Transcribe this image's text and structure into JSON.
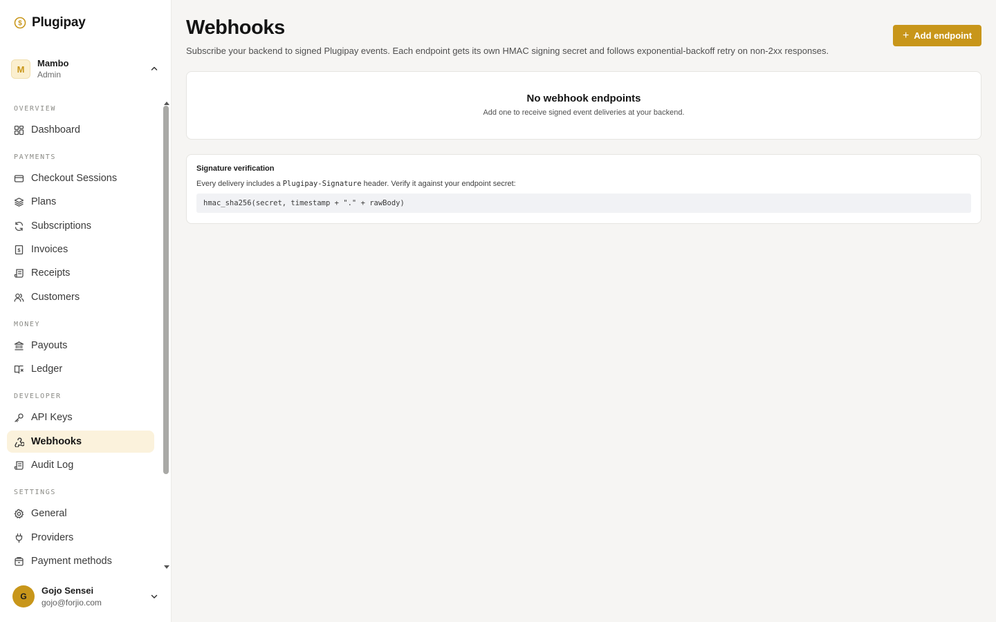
{
  "brand": {
    "name": "Plugipay",
    "accent": "#c8961a"
  },
  "org": {
    "initial": "M",
    "name": "Mambo",
    "role": "Admin"
  },
  "nav": {
    "sections": [
      {
        "label": "Overview"
      },
      {
        "label": "Payments"
      },
      {
        "label": "Money"
      },
      {
        "label": "Developer"
      },
      {
        "label": "Settings"
      }
    ],
    "items": [
      {
        "label": "Dashboard",
        "icon": "grid-icon"
      },
      {
        "label": "Checkout Sessions",
        "icon": "card-icon"
      },
      {
        "label": "Plans",
        "icon": "layers-icon"
      },
      {
        "label": "Subscriptions",
        "icon": "refresh-icon"
      },
      {
        "label": "Invoices",
        "icon": "dollar-file-icon"
      },
      {
        "label": "Receipts",
        "icon": "receipt-icon"
      },
      {
        "label": "Customers",
        "icon": "users-icon"
      },
      {
        "label": "Payouts",
        "icon": "bank-icon"
      },
      {
        "label": "Ledger",
        "icon": "book-icon"
      },
      {
        "label": "API Keys",
        "icon": "key-icon"
      },
      {
        "label": "Webhooks",
        "icon": "webhook-icon",
        "active": true
      },
      {
        "label": "Audit Log",
        "icon": "log-icon"
      },
      {
        "label": "General",
        "icon": "gear-icon"
      },
      {
        "label": "Providers",
        "icon": "plug-icon"
      },
      {
        "label": "Payment methods",
        "icon": "wallet-icon"
      }
    ]
  },
  "user": {
    "initial": "G",
    "name": "Gojo Sensei",
    "email": "gojo@forjio.com"
  },
  "page": {
    "title": "Webhooks",
    "subtitle": "Subscribe your backend to signed Plugipay events. Each endpoint gets its own HMAC signing secret and follows exponential-backoff retry on non-2xx responses.",
    "add_button": "Add endpoint"
  },
  "empty_state": {
    "title": "No webhook endpoints",
    "subtitle": "Add one to receive signed event deliveries at your backend."
  },
  "signature": {
    "title": "Signature verification",
    "text_before": "Every delivery includes a ",
    "header_name": "Plugipay-Signature",
    "text_after": " header. Verify it against your endpoint secret:",
    "code": "hmac_sha256(secret, timestamp + \".\" + rawBody)"
  }
}
